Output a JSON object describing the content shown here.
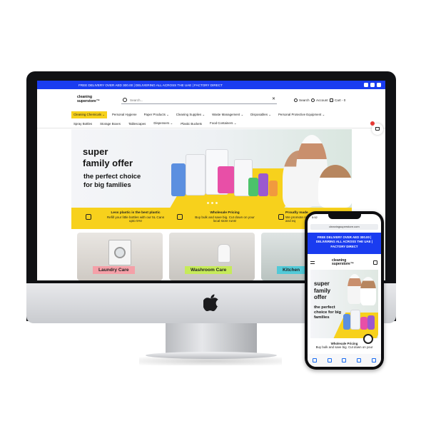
{
  "topbar": {
    "text": "FREE DELIVERY OVER AED 300.00 | DELIVERING ALL ACROSS THE UAE | FACTORY DIRECT",
    "social_icons": [
      "instagram-icon",
      "linkedin-icon",
      "whatsapp-icon"
    ]
  },
  "header": {
    "logo_line1": "cleaning",
    "logo_line2": "superstore™",
    "search_placeholder": "Search...",
    "search_link": "Search",
    "account_link": "Account",
    "cart_link": "Cart - 0"
  },
  "nav_primary": [
    "Cleaning Chemicals ⌄",
    "Personal Hygiene",
    "Paper Products ⌄",
    "Cleaning Supplies ⌄",
    "Waste Management ⌄",
    "Disposables ⌄",
    "Personal Protective Equipment ⌄"
  ],
  "nav_secondary": [
    "Spray Bottles",
    "Storage Boxes",
    "Tablescapes",
    "Dispensers ⌄",
    "Plastic Buckets",
    "Food Containers ⌄"
  ],
  "banner": {
    "headline_line1": "super",
    "headline_line2": "family offer",
    "sub_line1": "the perfect choice",
    "sub_line2": "for big families"
  },
  "features": [
    {
      "title": "Less plastic is the best plastic",
      "text1": "Refill your little bottles with our 5L Cans",
      "text2": "upto 5%!"
    },
    {
      "title": "Wholesale Pricing",
      "text1": "Buy bulk and save big. Cut down on your",
      "text2": "local store runs!"
    },
    {
      "title": "Proudly made",
      "text1": "We promote respo",
      "text2": "and eq"
    }
  ],
  "categories": [
    {
      "label": "Laundry Care",
      "color": "#f4a0a8"
    },
    {
      "label": "Washroom Care",
      "color": "#c6ea5a"
    },
    {
      "label": "Kitchen",
      "color": "#52c9d7"
    }
  ],
  "floating_cart_badge": "0",
  "phone": {
    "status_time": "5:52",
    "url": "cleaningsuperstore.com",
    "topbar_line1": "FREE DELIVERY OVER AED 300.00 |",
    "topbar_line2": "DELIVERING ALL ACROSS THE UAE |",
    "topbar_line3": "FACTORY DIRECT",
    "logo_line1": "cleaning",
    "logo_line2": "superstore™",
    "headline_line1": "super",
    "headline_line2": "family",
    "headline_line3": "offer",
    "sub_line1": "the perfect",
    "sub_line2": "choice for big",
    "sub_line3": "families",
    "feature_title": "Wholesale Pricing",
    "feature_text": "Buy bulk and save big. Cut down on your"
  },
  "colors": {
    "brand_blue": "#1a3cf0",
    "brand_yellow": "#f7d11c"
  }
}
